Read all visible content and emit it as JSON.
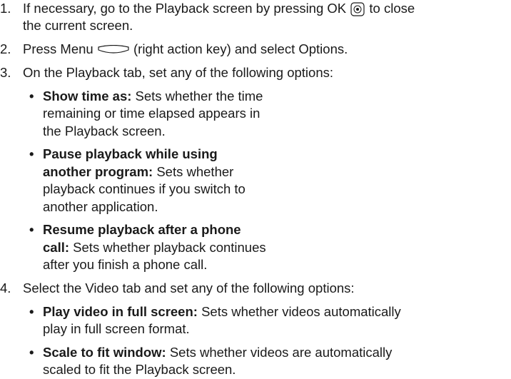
{
  "steps": [
    {
      "number": "1.",
      "text_before_icon": "If necessary, go to the Playback screen by pressing OK",
      "icon": "ok-button-icon",
      "text_after_icon_line1": "to close",
      "text_line2": "the current screen."
    },
    {
      "number": "2.",
      "text_before_icon": "Press Menu",
      "icon": "right-action-key-icon",
      "text_after_icon": "(right action key) and select Options."
    },
    {
      "number": "3.",
      "text": "On the Playback tab, set any of the following options:",
      "options": [
        {
          "term": "Show time as:",
          "lines": [
            "Sets whether the time",
            "remaining or time elapsed appears in",
            "the Playback screen."
          ]
        },
        {
          "term_line1": "Pause playback while using",
          "term_line2": "another program:",
          "lines": [
            "Sets whether",
            "playback continues if you switch to",
            "another application."
          ]
        },
        {
          "term_line1": "Resume playback after a phone",
          "term_line2": "call:",
          "lines": [
            "Sets whether playback continues",
            "after you finish a phone call."
          ]
        }
      ]
    },
    {
      "number": "4.",
      "text": "Select the Video tab and set any of the following options:",
      "options": [
        {
          "term": "Play video in full screen:",
          "lines": [
            "Sets whether videos automatically",
            "play in full screen format."
          ]
        },
        {
          "term": "Scale to fit window:",
          "lines": [
            "Sets whether videos are automatically",
            "scaled to fit the Playback screen."
          ]
        }
      ]
    }
  ],
  "bullet_char": "•",
  "colors": {
    "text": "#1a1a1a",
    "icon_stroke": "#1a1a1a"
  }
}
